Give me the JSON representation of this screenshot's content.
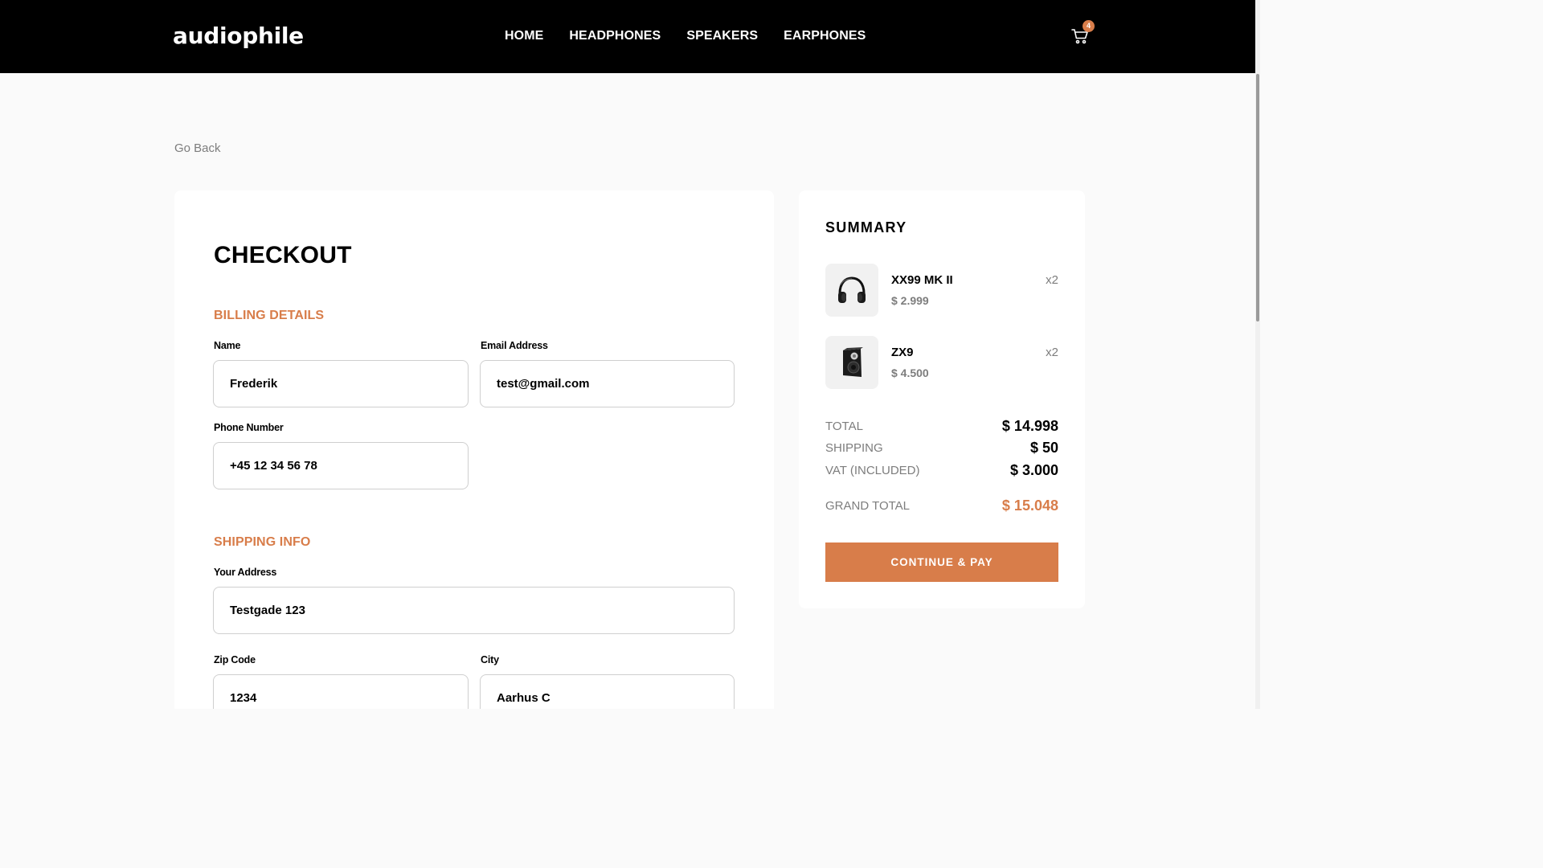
{
  "header": {
    "logo": "audiophile",
    "nav": [
      "HOME",
      "HEADPHONES",
      "SPEAKERS",
      "EARPHONES"
    ],
    "cart_icon": "cart-icon",
    "cart_count": "4"
  },
  "go_back": "Go Back",
  "checkout": {
    "title": "CHECKOUT",
    "billing": {
      "title": "BILLING DETAILS",
      "name_label": "Name",
      "name_value": "Frederik",
      "email_label": "Email Address",
      "email_value": "test@gmail.com",
      "phone_label": "Phone Number",
      "phone_value": "+45 12 34 56 78"
    },
    "shipping": {
      "title": "SHIPPING INFO",
      "address_label": "Your Address",
      "address_value": "Testgade 123",
      "zip_label": "Zip Code",
      "zip_value": "1234",
      "city_label": "City",
      "city_value": "Aarhus C"
    }
  },
  "summary": {
    "title": "SUMMARY",
    "items": [
      {
        "name": "XX99 MK II",
        "price": "$ 2.999",
        "qty": "x2",
        "icon": "headphones-icon"
      },
      {
        "name": "ZX9",
        "price": "$ 4.500",
        "qty": "x2",
        "icon": "speaker-icon"
      }
    ],
    "total_label": "TOTAL",
    "total_value": "$ 14.998",
    "shipping_label": "SHIPPING",
    "shipping_value": "$ 50",
    "vat_label": "VAT (INCLUDED)",
    "vat_value": "$ 3.000",
    "grand_total_label": "GRAND TOTAL",
    "grand_total_value": "$ 15.048",
    "pay_button": "CONTINUE & PAY"
  },
  "colors": {
    "accent": "#d87d4a",
    "header_bg": "#000000",
    "page_bg": "#fafafa",
    "muted_text": "#7d7d7d"
  }
}
